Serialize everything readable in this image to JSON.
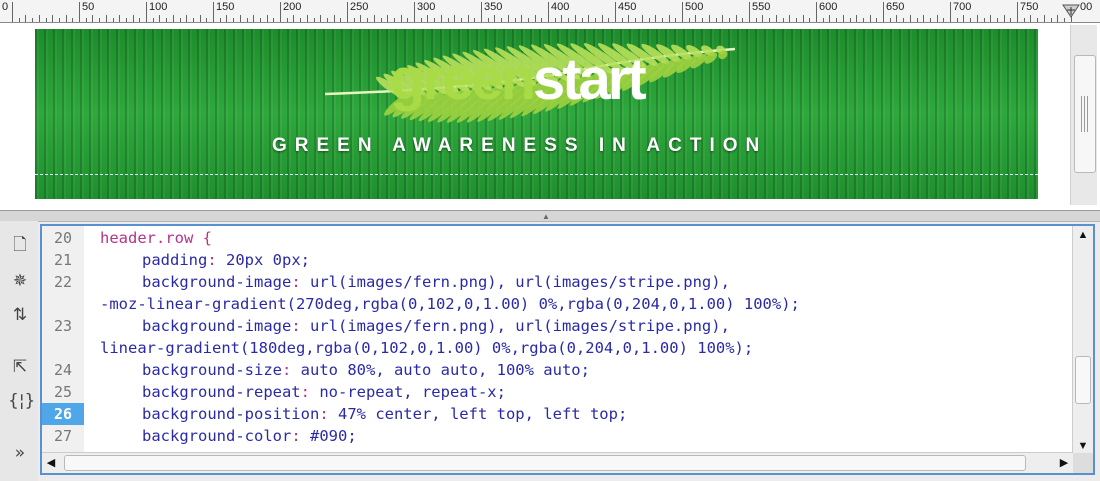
{
  "ruler": {
    "labels": [
      "0",
      "50",
      "100",
      "150",
      "200",
      "250",
      "300",
      "350",
      "400",
      "450",
      "500",
      "550",
      "600",
      "650",
      "700",
      "750",
      "00"
    ]
  },
  "banner": {
    "logo_green": "green",
    "logo_white": "start",
    "tagline": "GREEN AWARENESS IN ACTION",
    "colors": {
      "leaf": "#a8db45",
      "bg": "#2a9d3a"
    }
  },
  "toolbar": {
    "icons": [
      "file-icon",
      "gear-icon",
      "expand-icon",
      "select-icon",
      "braces-icon",
      "more-icon"
    ]
  },
  "code": {
    "active_line": "26",
    "lines": [
      {
        "num": "20",
        "sel": "header.row {",
        "prop": "",
        "val": ""
      },
      {
        "num": "21",
        "sel": "",
        "prop": "padding",
        "val": " 20px 0px;"
      },
      {
        "num": "22",
        "sel": "",
        "prop": "background-image",
        "val": " url(images/fern.png), url(images/stripe.png),"
      },
      {
        "num": "",
        "sel": "",
        "prop": "",
        "val": "-moz-linear-gradient(270deg,rgba(0,102,0,1.00) 0%,rgba(0,204,0,1.00) 100%);"
      },
      {
        "num": "23",
        "sel": "",
        "prop": "background-image",
        "val": " url(images/fern.png), url(images/stripe.png),"
      },
      {
        "num": "",
        "sel": "",
        "prop": "",
        "val": "linear-gradient(180deg,rgba(0,102,0,1.00) 0%,rgba(0,204,0,1.00) 100%);"
      },
      {
        "num": "24",
        "sel": "",
        "prop": "background-size",
        "val": " auto 80%, auto auto, 100% auto;"
      },
      {
        "num": "25",
        "sel": "",
        "prop": "background-repeat",
        "val": " no-repeat, repeat-x;"
      },
      {
        "num": "26",
        "sel": "",
        "prop": "background-position",
        "val": " 47% center, left top, left top;"
      },
      {
        "num": "27",
        "sel": "",
        "prop": "background-color",
        "val": " #090;"
      }
    ]
  }
}
